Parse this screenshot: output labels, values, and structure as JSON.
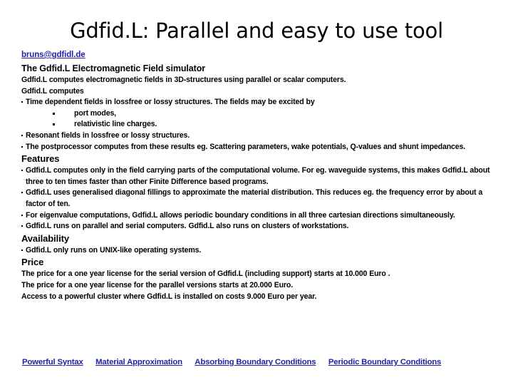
{
  "slide": {
    "title": "Gdfid.L: Parallel and easy to use tool",
    "email": "bruns@gdfidl.de",
    "subtitle": "The Gdfid.L Electromagnetic Field simulator",
    "intro": [
      "Gdfid.L computes electromagnetic fields in 3D-structures using parallel or scalar computers.",
      "Gdfid.L computes"
    ],
    "time_dependent_bullet": "Time dependent fields in lossfree or lossy structures. The fields may be excited by",
    "sub_bullets": [
      "port modes,",
      "relativistic line charges."
    ],
    "resonant_bullet": "Resonant fields in lossfree or lossy structures.",
    "postprocessor_bullet": "The postprocessor computes from these results eg. Scattering parameters, wake potentials, Q-values and shunt impedances.",
    "features_heading": "Features",
    "features_bullets": [
      "Gdfid.L computes only in the field carrying parts of the computational volume. For eg. waveguide systems, this makes Gdfid.L about three to ten times faster than other Finite Difference based programs.",
      "Gdfid.L uses generalised diagonal fillings to approximate the material distribution. This reduces eg. the frequency error by about a factor of ten.",
      "For eigenvalue computations, Gdfid.L allows periodic boundary conditions in all three cartesian directions simultaneously.",
      "Gdfid.L runs on parallel and serial computers. Gdfid.L also runs on clusters of workstations."
    ],
    "availability_heading": "Availability",
    "availability_bullets": [
      "Gdfid.L only runs on UNIX-like operating systems."
    ],
    "price_heading": "Price",
    "price_lines": [
      "The price for a one year license for the serial version of Gdfid.L (including support) starts at 10.000 Euro .",
      "The price for a one year license for the parallel versions starts at 20.000 Euro.",
      "Access to a powerful cluster where Gdfid.L is installed on costs 9.000 Euro per year."
    ],
    "nav_links": [
      "Powerful Syntax",
      "Material Approximation",
      "Absorbing Boundary Conditions",
      "Periodic Boundary Conditions"
    ],
    "colors": {
      "link": "#2222aa",
      "text": "#000000",
      "background": "#ffffff"
    }
  }
}
